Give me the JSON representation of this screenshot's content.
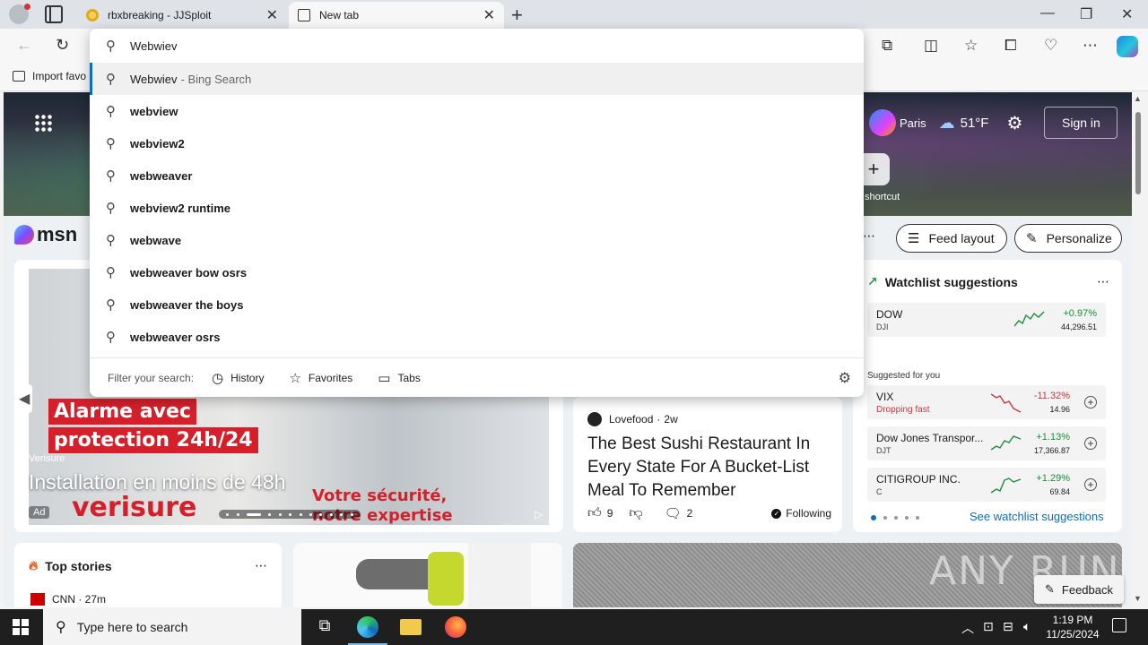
{
  "browser": {
    "tabs": [
      {
        "title": "rbxbreaking - JJSploit",
        "active": false
      },
      {
        "title": "New tab",
        "active": true
      }
    ],
    "address_bar": {
      "value": "Webwiev"
    },
    "favorites_bar": {
      "import_label": "Import favo"
    }
  },
  "omnibox": {
    "suggestions": [
      {
        "text": "Webwiev",
        "suffix": "- Bing Search",
        "selected": true
      },
      {
        "text": "webview"
      },
      {
        "text": "webview2"
      },
      {
        "text": "webweaver"
      },
      {
        "text": "webview2 runtime"
      },
      {
        "text": "webwave"
      },
      {
        "text": "webweaver bow osrs"
      },
      {
        "text": "webweaver the boys"
      },
      {
        "text": "webweaver osrs"
      }
    ],
    "filter": {
      "label": "Filter your search:",
      "options": [
        "History",
        "Favorites",
        "Tabs"
      ]
    }
  },
  "msn": {
    "logo": "msn",
    "weather": {
      "location": "Paris",
      "temp": "51°F"
    },
    "sign_in": "Sign in",
    "add_shortcut_label": "shortcut",
    "feed_layout": "Feed layout",
    "personalize": "Personalize",
    "ad": {
      "banner_line1": "Alarme avec",
      "banner_line2": "protection 24h/24",
      "source": "Verisure",
      "headline": "Installation en moins de 48h",
      "badge": "Ad",
      "brand": "verisure",
      "tagline_line1": "Votre sécurité,",
      "tagline_line2": "notre expertise"
    },
    "article": {
      "source": "Lovefood",
      "age": "2w",
      "title": "The Best Sushi Restaurant In Every State For A Bucket-List Meal To Remember",
      "likes": "9",
      "comments": "2",
      "following": "Following"
    },
    "watchlist": {
      "title": "Watchlist suggestions",
      "top": {
        "name": "DOW",
        "ticker": "DJI",
        "change": "+0.97%",
        "price": "44,296.51",
        "color": "#1a8f3c"
      },
      "suggested_label": "Suggested for you",
      "items": [
        {
          "name": "VIX",
          "sub": "Dropping fast",
          "change": "-11.32%",
          "price": "14.96",
          "color": "#d13438"
        },
        {
          "name": "Dow Jones Transpor...",
          "sub": "DJT",
          "change": "+1.13%",
          "price": "17,366.87",
          "color": "#1a8f3c"
        },
        {
          "name": "CITIGROUP INC.",
          "sub": "C",
          "change": "+1.29%",
          "price": "69.84",
          "color": "#1a8f3c"
        }
      ],
      "see_more": "See watchlist suggestions"
    },
    "top_stories": {
      "title": "Top stories",
      "first_source": "CNN · 27m"
    },
    "feedback": "Feedback",
    "watermark": "ANY RUN"
  },
  "taskbar": {
    "search_placeholder": "Type here to search",
    "time": "1:19 PM",
    "date": "11/25/2024"
  }
}
